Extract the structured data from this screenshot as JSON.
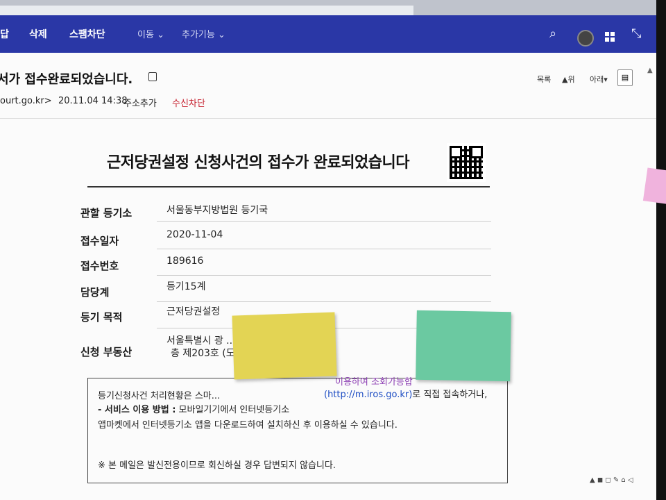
{
  "navbar": {
    "items": [
      "답",
      "삭제",
      "스팸차단",
      "이동",
      "추가기능"
    ],
    "icons": [
      "search-icon",
      "avatar",
      "apps-icon",
      "shrink-icon"
    ]
  },
  "mail": {
    "subject": "서가 접수완료되었습니다.",
    "sender": "ourt.go.kr>",
    "date": "20.11.04 14:38",
    "add_address": "주소추가",
    "block": "수신차단",
    "toolbar": {
      "list": "목록",
      "up": "▲위",
      "down": "아래▾"
    }
  },
  "document": {
    "title": "근저당권설정 신청사건의 접수가 완료되었습니다",
    "rows": [
      {
        "label": "관할 등기소",
        "value": "서울동부지방법원 등기국"
      },
      {
        "label": "접수일자",
        "value": "2020-11-04"
      },
      {
        "label": "접수번호",
        "value": "189616"
      },
      {
        "label": "담당계",
        "value": "등기15계"
      },
      {
        "label": "등기 목적",
        "value": "근저당권설정"
      },
      {
        "label": "신청 부동산",
        "value": "서울특별시 광 ... 필지 광장동신동아파",
        "value2": "층 제203호 (도..."
      }
    ],
    "notice": {
      "line1": "등기신청사건 처리현황은 스마...",
      "line1_link": "이용하여 조회가능합",
      "line1b": "(http://m.iros.go.kr)",
      "line1c": "로 직접 접속하거나,",
      "line2_bold": "- 서비스 이용 방법 :",
      "line2": " 모바일기기에서 인터넷등기소",
      "line3": "앱마켓에서 인터넷등기소 앱을 다운로드하여 설치하신 후 이용하실 수 있습니다.",
      "line4": "※ 본 메일은 발신전용이므로 회신하실 경우 답변되지 않습니다."
    }
  },
  "colors": {
    "navbar": "#2a37a6",
    "block": "#c6202e",
    "link": "#1c4cc3"
  }
}
